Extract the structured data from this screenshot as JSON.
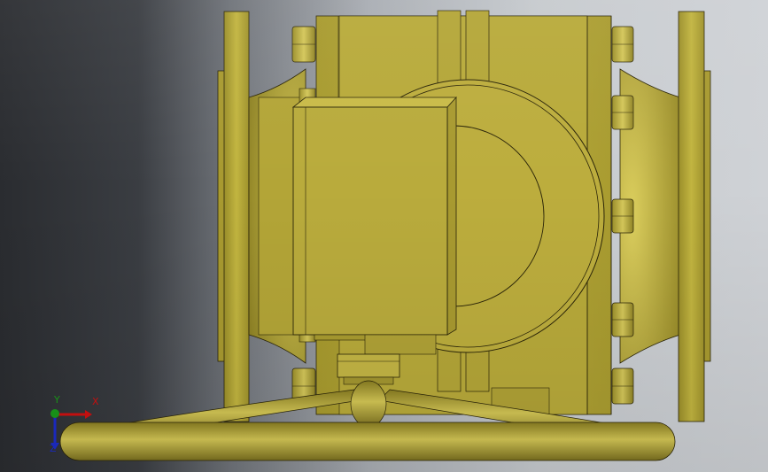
{
  "viewport": {
    "background_left": "#2a2c30",
    "background_right": "#cfd2d6"
  },
  "model": {
    "component": "valve-assembly",
    "body_color": "#b7a938",
    "highlight_color": "#d9cc5a",
    "shadow_color": "#7f7420",
    "edge_color": "#2b2508"
  },
  "triad": {
    "x_label": "X",
    "y_label": "Y",
    "z_label": "Z",
    "x_color": "#d01010",
    "y_color": "#1a9a1a",
    "z_color": "#1c2cc8"
  }
}
